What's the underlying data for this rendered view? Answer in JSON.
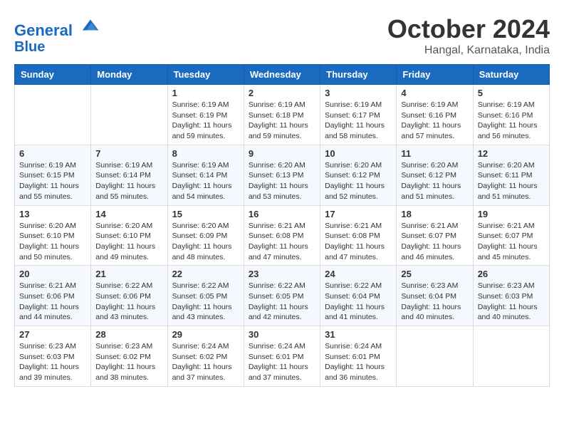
{
  "header": {
    "logo_line1": "General",
    "logo_line2": "Blue",
    "month": "October 2024",
    "location": "Hangal, Karnataka, India"
  },
  "weekdays": [
    "Sunday",
    "Monday",
    "Tuesday",
    "Wednesday",
    "Thursday",
    "Friday",
    "Saturday"
  ],
  "weeks": [
    [
      {
        "day": "",
        "sunrise": "",
        "sunset": "",
        "daylight": ""
      },
      {
        "day": "",
        "sunrise": "",
        "sunset": "",
        "daylight": ""
      },
      {
        "day": "1",
        "sunrise": "Sunrise: 6:19 AM",
        "sunset": "Sunset: 6:19 PM",
        "daylight": "Daylight: 11 hours and 59 minutes."
      },
      {
        "day": "2",
        "sunrise": "Sunrise: 6:19 AM",
        "sunset": "Sunset: 6:18 PM",
        "daylight": "Daylight: 11 hours and 59 minutes."
      },
      {
        "day": "3",
        "sunrise": "Sunrise: 6:19 AM",
        "sunset": "Sunset: 6:17 PM",
        "daylight": "Daylight: 11 hours and 58 minutes."
      },
      {
        "day": "4",
        "sunrise": "Sunrise: 6:19 AM",
        "sunset": "Sunset: 6:16 PM",
        "daylight": "Daylight: 11 hours and 57 minutes."
      },
      {
        "day": "5",
        "sunrise": "Sunrise: 6:19 AM",
        "sunset": "Sunset: 6:16 PM",
        "daylight": "Daylight: 11 hours and 56 minutes."
      }
    ],
    [
      {
        "day": "6",
        "sunrise": "Sunrise: 6:19 AM",
        "sunset": "Sunset: 6:15 PM",
        "daylight": "Daylight: 11 hours and 55 minutes."
      },
      {
        "day": "7",
        "sunrise": "Sunrise: 6:19 AM",
        "sunset": "Sunset: 6:14 PM",
        "daylight": "Daylight: 11 hours and 55 minutes."
      },
      {
        "day": "8",
        "sunrise": "Sunrise: 6:19 AM",
        "sunset": "Sunset: 6:14 PM",
        "daylight": "Daylight: 11 hours and 54 minutes."
      },
      {
        "day": "9",
        "sunrise": "Sunrise: 6:20 AM",
        "sunset": "Sunset: 6:13 PM",
        "daylight": "Daylight: 11 hours and 53 minutes."
      },
      {
        "day": "10",
        "sunrise": "Sunrise: 6:20 AM",
        "sunset": "Sunset: 6:12 PM",
        "daylight": "Daylight: 11 hours and 52 minutes."
      },
      {
        "day": "11",
        "sunrise": "Sunrise: 6:20 AM",
        "sunset": "Sunset: 6:12 PM",
        "daylight": "Daylight: 11 hours and 51 minutes."
      },
      {
        "day": "12",
        "sunrise": "Sunrise: 6:20 AM",
        "sunset": "Sunset: 6:11 PM",
        "daylight": "Daylight: 11 hours and 51 minutes."
      }
    ],
    [
      {
        "day": "13",
        "sunrise": "Sunrise: 6:20 AM",
        "sunset": "Sunset: 6:10 PM",
        "daylight": "Daylight: 11 hours and 50 minutes."
      },
      {
        "day": "14",
        "sunrise": "Sunrise: 6:20 AM",
        "sunset": "Sunset: 6:10 PM",
        "daylight": "Daylight: 11 hours and 49 minutes."
      },
      {
        "day": "15",
        "sunrise": "Sunrise: 6:20 AM",
        "sunset": "Sunset: 6:09 PM",
        "daylight": "Daylight: 11 hours and 48 minutes."
      },
      {
        "day": "16",
        "sunrise": "Sunrise: 6:21 AM",
        "sunset": "Sunset: 6:08 PM",
        "daylight": "Daylight: 11 hours and 47 minutes."
      },
      {
        "day": "17",
        "sunrise": "Sunrise: 6:21 AM",
        "sunset": "Sunset: 6:08 PM",
        "daylight": "Daylight: 11 hours and 47 minutes."
      },
      {
        "day": "18",
        "sunrise": "Sunrise: 6:21 AM",
        "sunset": "Sunset: 6:07 PM",
        "daylight": "Daylight: 11 hours and 46 minutes."
      },
      {
        "day": "19",
        "sunrise": "Sunrise: 6:21 AM",
        "sunset": "Sunset: 6:07 PM",
        "daylight": "Daylight: 11 hours and 45 minutes."
      }
    ],
    [
      {
        "day": "20",
        "sunrise": "Sunrise: 6:21 AM",
        "sunset": "Sunset: 6:06 PM",
        "daylight": "Daylight: 11 hours and 44 minutes."
      },
      {
        "day": "21",
        "sunrise": "Sunrise: 6:22 AM",
        "sunset": "Sunset: 6:06 PM",
        "daylight": "Daylight: 11 hours and 43 minutes."
      },
      {
        "day": "22",
        "sunrise": "Sunrise: 6:22 AM",
        "sunset": "Sunset: 6:05 PM",
        "daylight": "Daylight: 11 hours and 43 minutes."
      },
      {
        "day": "23",
        "sunrise": "Sunrise: 6:22 AM",
        "sunset": "Sunset: 6:05 PM",
        "daylight": "Daylight: 11 hours and 42 minutes."
      },
      {
        "day": "24",
        "sunrise": "Sunrise: 6:22 AM",
        "sunset": "Sunset: 6:04 PM",
        "daylight": "Daylight: 11 hours and 41 minutes."
      },
      {
        "day": "25",
        "sunrise": "Sunrise: 6:23 AM",
        "sunset": "Sunset: 6:04 PM",
        "daylight": "Daylight: 11 hours and 40 minutes."
      },
      {
        "day": "26",
        "sunrise": "Sunrise: 6:23 AM",
        "sunset": "Sunset: 6:03 PM",
        "daylight": "Daylight: 11 hours and 40 minutes."
      }
    ],
    [
      {
        "day": "27",
        "sunrise": "Sunrise: 6:23 AM",
        "sunset": "Sunset: 6:03 PM",
        "daylight": "Daylight: 11 hours and 39 minutes."
      },
      {
        "day": "28",
        "sunrise": "Sunrise: 6:23 AM",
        "sunset": "Sunset: 6:02 PM",
        "daylight": "Daylight: 11 hours and 38 minutes."
      },
      {
        "day": "29",
        "sunrise": "Sunrise: 6:24 AM",
        "sunset": "Sunset: 6:02 PM",
        "daylight": "Daylight: 11 hours and 37 minutes."
      },
      {
        "day": "30",
        "sunrise": "Sunrise: 6:24 AM",
        "sunset": "Sunset: 6:01 PM",
        "daylight": "Daylight: 11 hours and 37 minutes."
      },
      {
        "day": "31",
        "sunrise": "Sunrise: 6:24 AM",
        "sunset": "Sunset: 6:01 PM",
        "daylight": "Daylight: 11 hours and 36 minutes."
      },
      {
        "day": "",
        "sunrise": "",
        "sunset": "",
        "daylight": ""
      },
      {
        "day": "",
        "sunrise": "",
        "sunset": "",
        "daylight": ""
      }
    ]
  ]
}
